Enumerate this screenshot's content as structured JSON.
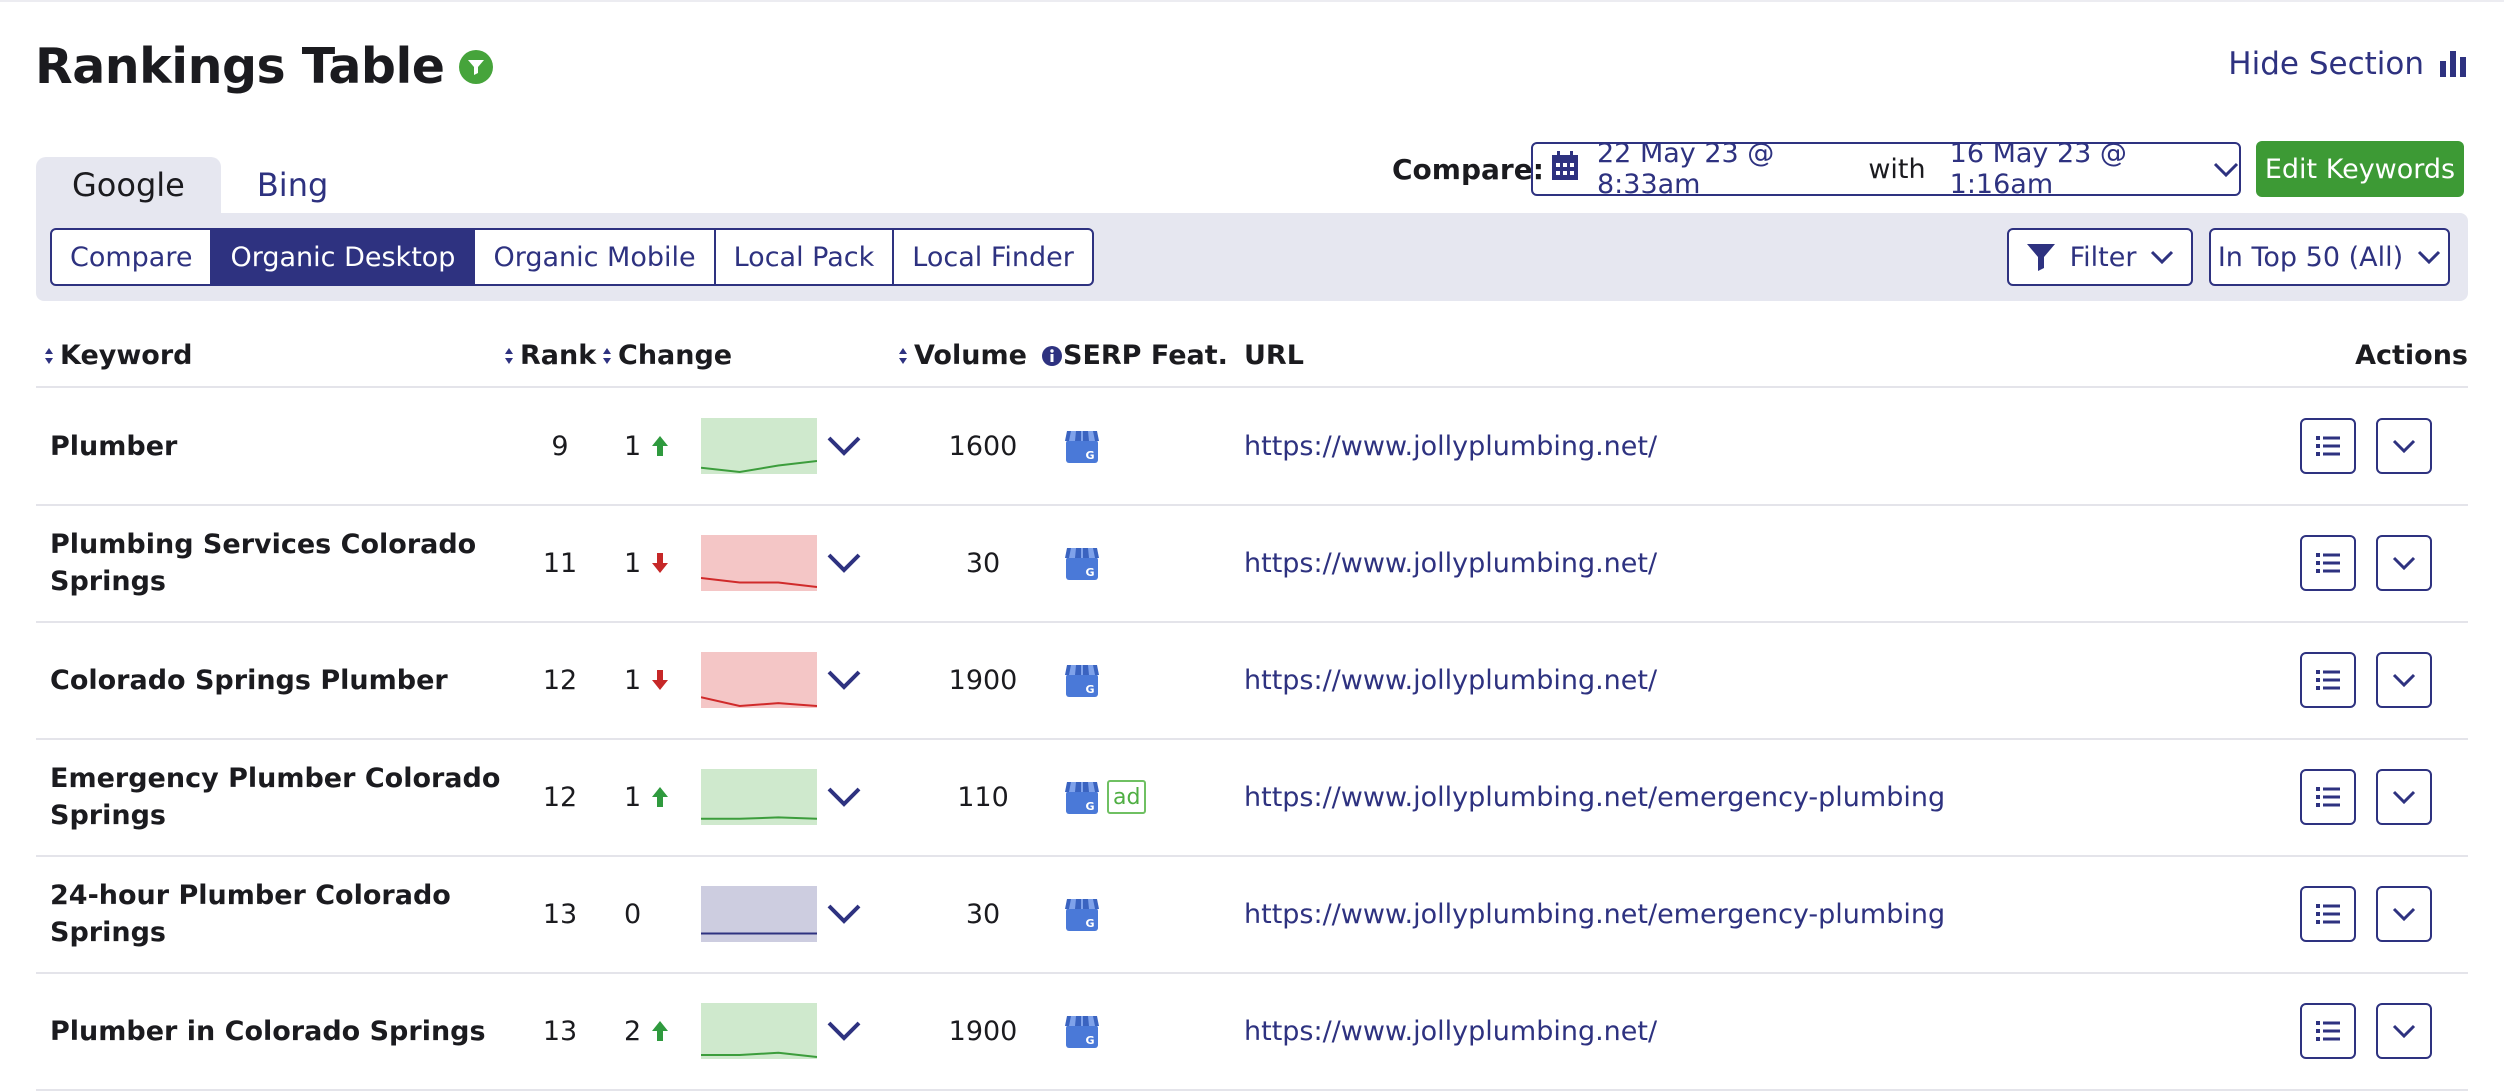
{
  "header": {
    "title": "Rankings Table",
    "hide_section": "Hide Section"
  },
  "engine_tabs": [
    {
      "label": "Google",
      "active": true
    },
    {
      "label": "Bing",
      "active": false
    }
  ],
  "compare": {
    "label": "Compare:",
    "date_from": "22 May 23 @ 8:33am",
    "with": "with",
    "date_to": "16 May 23 @ 1:16am"
  },
  "edit_keywords": "Edit Keywords",
  "view_tabs": [
    "Compare",
    "Organic Desktop",
    "Organic Mobile",
    "Local Pack",
    "Local Finder"
  ],
  "active_view": "Organic Desktop",
  "filter_label": "Filter",
  "top_filter_label": "In Top 50 (All)",
  "columns": {
    "keyword": "Keyword",
    "rank": "Rank",
    "change": "Change",
    "volume": "Volume",
    "serp": "SERP Feat.",
    "url": "URL",
    "actions": "Actions"
  },
  "colors": {
    "accent": "#2e3280",
    "green": "#3d9a35",
    "up": "#2f9a3e",
    "down": "#c62828"
  },
  "rows": [
    {
      "keyword": "Plumber",
      "rank": "9",
      "change": "1",
      "dir": "up",
      "trend": [
        0.55,
        0.45,
        0.6,
        0.7
      ],
      "volume": "1600",
      "serp": [
        "local-pack-icon"
      ],
      "url": "https://www.jollyplumbing.net/"
    },
    {
      "keyword": "Plumbing Services Colorado Springs",
      "rank": "11",
      "change": "1",
      "dir": "down",
      "trend": [
        0.7,
        0.6,
        0.6,
        0.5
      ],
      "volume": "30",
      "serp": [
        "local-pack-icon"
      ],
      "url": "https://www.jollyplumbing.net/"
    },
    {
      "keyword": "Colorado Springs Plumber",
      "rank": "12",
      "change": "1",
      "dir": "down",
      "trend": [
        0.65,
        0.35,
        0.52,
        0.38
      ],
      "volume": "1900",
      "serp": [
        "local-pack-icon"
      ],
      "url": "https://www.jollyplumbing.net/"
    },
    {
      "keyword": "Emergency Plumber Colorado Springs",
      "rank": "12",
      "change": "1",
      "dir": "up",
      "trend": [
        0.55,
        0.55,
        0.58,
        0.55
      ],
      "volume": "110",
      "serp": [
        "local-pack-icon",
        "ad-icon"
      ],
      "ad_label": "ad",
      "url": "https://www.jollyplumbing.net/emergency-plumbing"
    },
    {
      "keyword": "24-hour Plumber Colorado Springs",
      "rank": "13",
      "change": "0",
      "dir": "none",
      "trend": [
        0.6,
        0.6,
        0.6,
        0.6
      ],
      "volume": "30",
      "serp": [
        "local-pack-icon"
      ],
      "url": "https://www.jollyplumbing.net/emergency-plumbing"
    },
    {
      "keyword": "Plumber in Colorado Springs",
      "rank": "13",
      "change": "2",
      "dir": "up",
      "trend": [
        0.5,
        0.5,
        0.55,
        0.35
      ],
      "volume": "1900",
      "serp": [
        "local-pack-icon"
      ],
      "url": "https://www.jollyplumbing.net/"
    }
  ]
}
